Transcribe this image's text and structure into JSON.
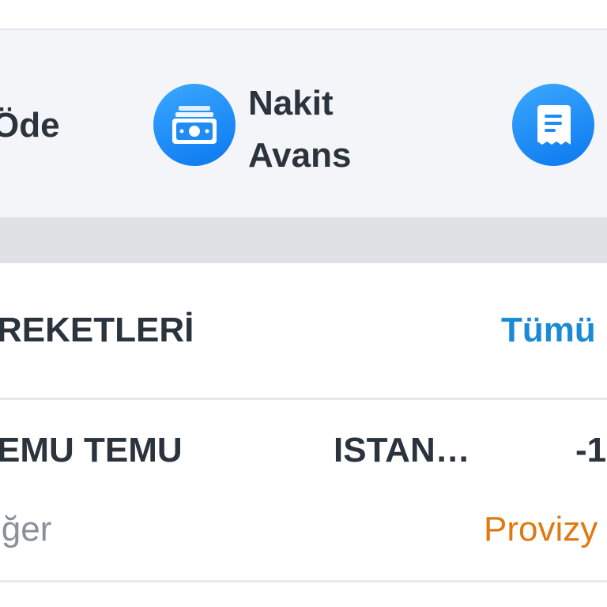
{
  "quick_actions": {
    "items": [
      {
        "label": "Öde",
        "icon": "pay-icon"
      },
      {
        "label_line1": "Nakit",
        "label_line2": "Avans",
        "icon": "cash-advance-icon"
      },
      {
        "label": "",
        "icon": "receipt-icon"
      }
    ],
    "icon_color": "#1a86f2"
  },
  "transactions_section": {
    "title": "REKETLERİ",
    "see_all_label": "Tümü",
    "accent_color": "#1a8ad6"
  },
  "transactions": [
    {
      "merchant": "EMU TEMU",
      "city": "ISTAN…",
      "amount": "-1",
      "category": "Diğer",
      "category_visible": "iğer",
      "status": "Provizy",
      "status_color": "#e07a10"
    }
  ]
}
